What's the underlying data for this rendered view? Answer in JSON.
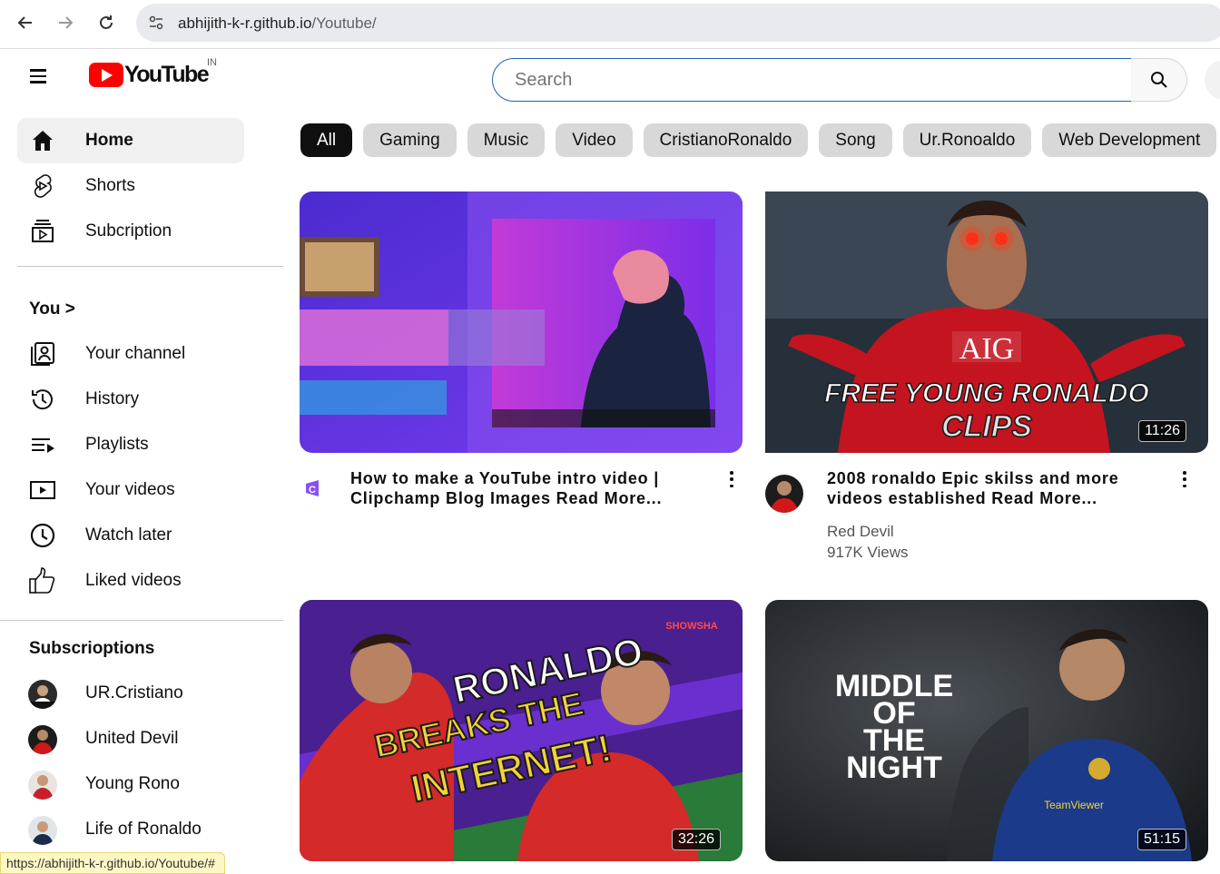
{
  "browser": {
    "url_host": "abhijith-k-r.github.io",
    "url_path": "/Youtube/",
    "status_url": "https://abhijith-k-r.github.io/Youtube/#"
  },
  "header": {
    "logo_text": "YouTube",
    "region": "IN",
    "search_placeholder": "Search"
  },
  "sidebar": {
    "main": [
      {
        "label": "Home",
        "icon": "home-icon",
        "active": true
      },
      {
        "label": "Shorts",
        "icon": "shorts-icon"
      },
      {
        "label": "Subcription",
        "icon": "subscriptions-icon"
      }
    ],
    "you_title": "You >",
    "you_items": [
      {
        "label": "Your channel",
        "icon": "channel-icon"
      },
      {
        "label": "History",
        "icon": "history-icon"
      },
      {
        "label": "Playlists",
        "icon": "playlists-icon"
      },
      {
        "label": "Your videos",
        "icon": "your-videos-icon"
      },
      {
        "label": "Watch later",
        "icon": "clock-icon"
      },
      {
        "label": "Liked videos",
        "icon": "thumbs-up-icon"
      }
    ],
    "subs_title": "Subscrioptions",
    "subs": [
      {
        "label": "UR.Cristiano"
      },
      {
        "label": "United Devil"
      },
      {
        "label": "Young Rono"
      },
      {
        "label": "Life of Ronaldo"
      }
    ]
  },
  "chips": [
    "All",
    "Gaming",
    "Music",
    "Video",
    "CristianoRonaldo",
    "Song",
    "Ur.Ronoaldo",
    "Web Development"
  ],
  "videos": [
    {
      "title": "How to make a YouTube intro video | Clipchamp Blog Images Read More...",
      "channel": "",
      "views": ""
    },
    {
      "title": "2008 ronaldo Epic skilss and more videos established Read More...",
      "channel": "Red Devil",
      "views": "917K Views",
      "duration": "11:26",
      "overlay_line1": "FREE YOUNG RONALDO",
      "overlay_line2": "CLIPS",
      "jersey": "AIG"
    },
    {
      "duration": "32:26",
      "overlay_line1": "RONALDO",
      "overlay_line2": "BREAKS THE",
      "overlay_line3": "INTERNET!",
      "badge": "SHOWSHA"
    },
    {
      "duration": "51:15",
      "overlay_line1": "MIDDLE",
      "overlay_line2": "OF",
      "overlay_line3": "THE",
      "overlay_line4": "NIGHT",
      "sponsor": "TeamViewer"
    }
  ]
}
